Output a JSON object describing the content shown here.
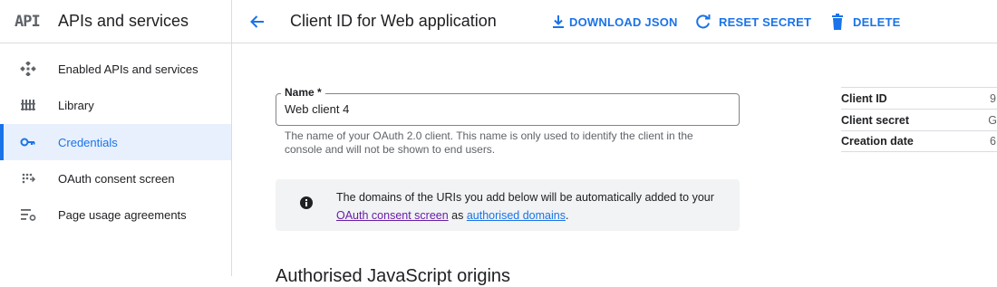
{
  "sidebar": {
    "logo": "API",
    "title": "APIs and services",
    "items": [
      {
        "label": "Enabled APIs and services",
        "icon": "enabled-apis-icon"
      },
      {
        "label": "Library",
        "icon": "library-icon"
      },
      {
        "label": "Credentials",
        "icon": "key-icon",
        "active": true
      },
      {
        "label": "OAuth consent screen",
        "icon": "consent-icon"
      },
      {
        "label": "Page usage agreements",
        "icon": "settings-list-icon"
      }
    ]
  },
  "header": {
    "title": "Client ID for Web application",
    "download_label": "DOWNLOAD JSON",
    "reset_label": "RESET SECRET",
    "delete_label": "DELETE"
  },
  "form": {
    "name_label": "Name *",
    "name_value": "Web client 4",
    "name_hint": "The name of your OAuth 2.0 client. This name is only used to identify the client in the console and will not be shown to end users."
  },
  "info": {
    "text_before": "The domains of the URIs you add below will be automatically added to your ",
    "link1": "OAuth consent screen",
    "text_mid": " as ",
    "link2": "authorised domains",
    "text_after": "."
  },
  "section": {
    "heading": "Authorised JavaScript origins"
  },
  "meta": {
    "rows": [
      {
        "key": "Client ID",
        "value": "9"
      },
      {
        "key": "Client secret",
        "value": "G"
      },
      {
        "key": "Creation date",
        "value": "6"
      }
    ]
  },
  "colors": {
    "accent": "#1a73e8",
    "visited_link": "#681da8",
    "info_bg": "#f1f3f4"
  }
}
